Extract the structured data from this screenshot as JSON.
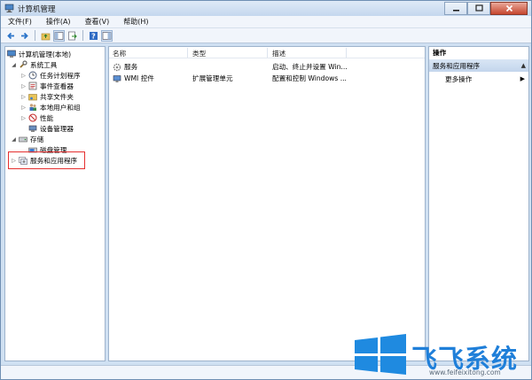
{
  "window": {
    "title": "计算机管理"
  },
  "menu": [
    "文件(F)",
    "操作(A)",
    "查看(V)",
    "帮助(H)"
  ],
  "tree": {
    "root": "计算机管理(本地)",
    "items": [
      {
        "label": "系统工具",
        "icon": "tools-icon"
      },
      {
        "label": "任务计划程序",
        "icon": "clock-icon"
      },
      {
        "label": "事件查看器",
        "icon": "event-viewer-icon"
      },
      {
        "label": "共享文件夹",
        "icon": "shared-folder-icon"
      },
      {
        "label": "本地用户和组",
        "icon": "users-icon"
      },
      {
        "label": "性能",
        "icon": "performance-icon"
      },
      {
        "label": "设备管理器",
        "icon": "device-manager-icon"
      },
      {
        "label": "存储",
        "icon": "storage-icon"
      },
      {
        "label": "磁盘管理",
        "icon": "disk-icon"
      },
      {
        "label": "服务和应用程序",
        "icon": "services-apps-icon"
      }
    ]
  },
  "list": {
    "columns": [
      "名称",
      "类型",
      "描述"
    ],
    "rows": [
      {
        "name": "服务",
        "type": "",
        "desc": "启动、终止并设置 Win..."
      },
      {
        "name": "WMI 控件",
        "type": "扩展管理单元",
        "desc": "配置和控制 Windows ..."
      }
    ]
  },
  "actions": {
    "header": "操作",
    "section": "服务和应用程序",
    "item": "更多操作"
  },
  "watermark": {
    "brand": "飞飞系统",
    "url": "www.feifeixitong.com"
  },
  "colors": {
    "highlight": "#e53030",
    "brand": "#1f7fd9"
  }
}
